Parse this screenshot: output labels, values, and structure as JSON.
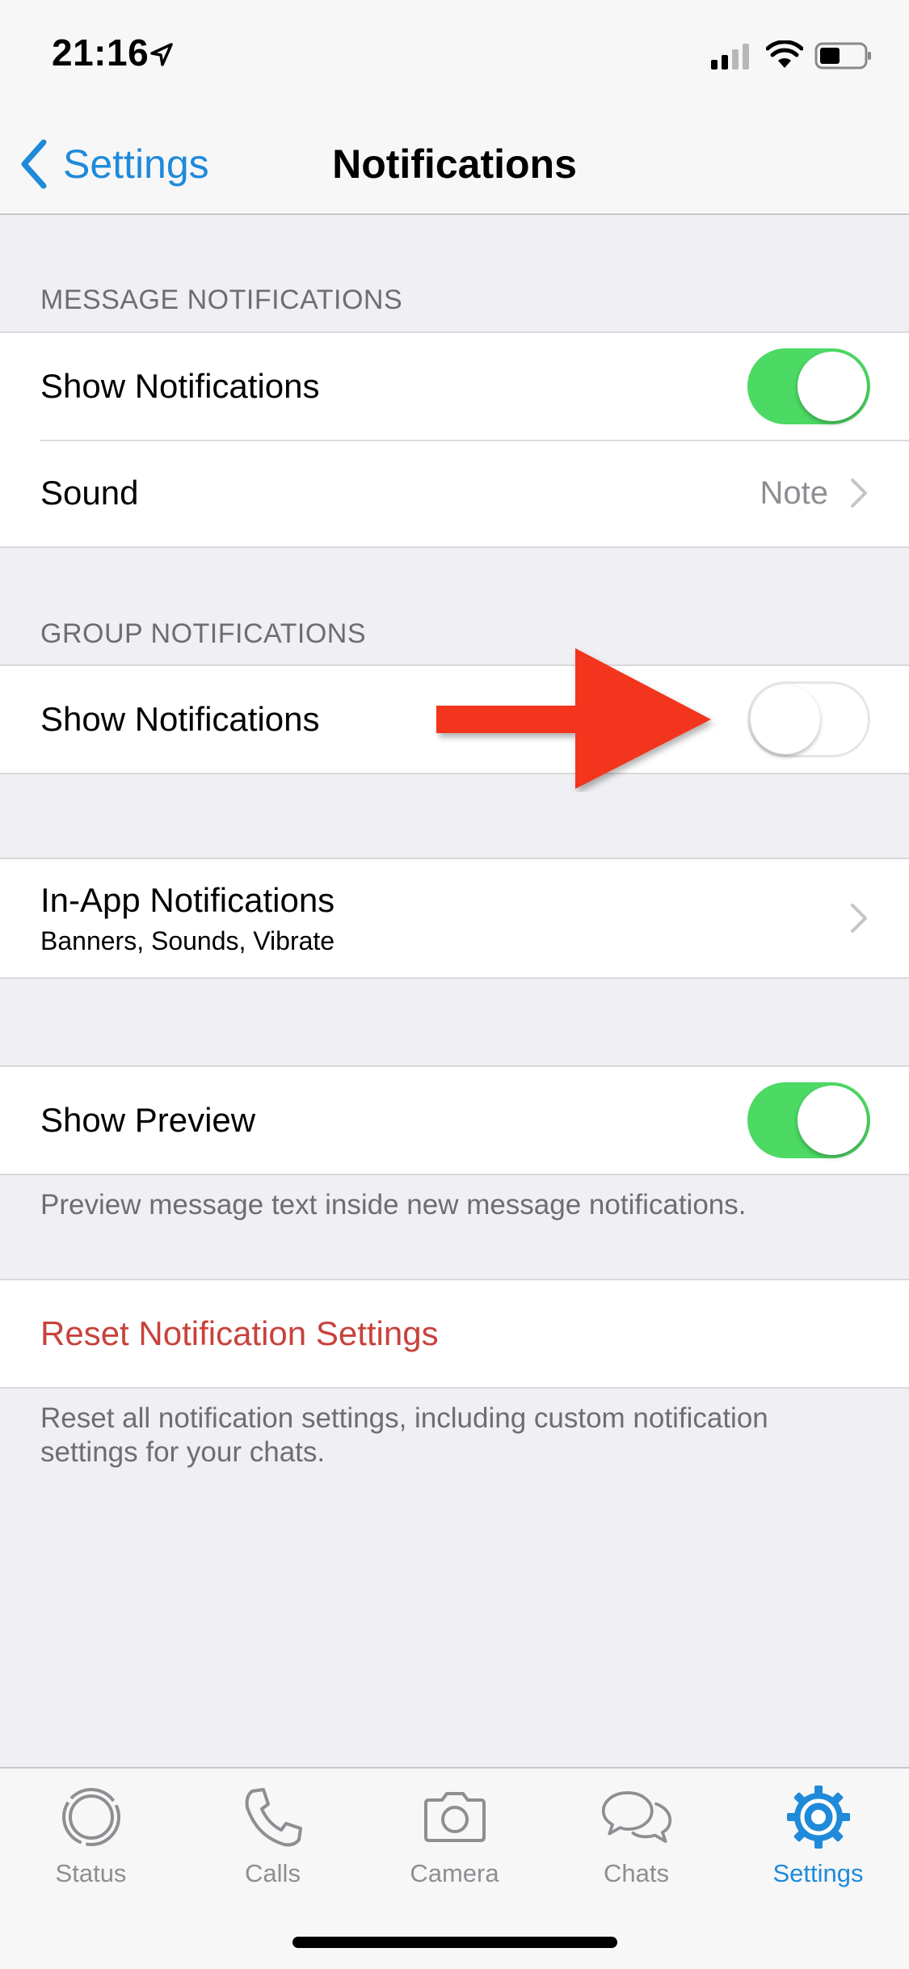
{
  "status_bar": {
    "time": "21:16"
  },
  "nav": {
    "back_label": "Settings",
    "title": "Notifications"
  },
  "message_notifications": {
    "header": "MESSAGE NOTIFICATIONS",
    "show_label": "Show Notifications",
    "show_enabled": true,
    "sound_label": "Sound",
    "sound_value": "Note"
  },
  "group_notifications": {
    "header": "GROUP NOTIFICATIONS",
    "show_label": "Show Notifications",
    "show_enabled": false
  },
  "in_app": {
    "label": "In-App Notifications",
    "subtitle": "Banners, Sounds, Vibrate"
  },
  "preview": {
    "label": "Show Preview",
    "enabled": true,
    "footer": "Preview message text inside new message notifications."
  },
  "reset": {
    "label": "Reset Notification Settings",
    "footer": "Reset all notification settings, including custom notification settings for your chats."
  },
  "tabs": [
    {
      "label": "Status",
      "icon": "status-icon"
    },
    {
      "label": "Calls",
      "icon": "phone-icon"
    },
    {
      "label": "Camera",
      "icon": "camera-icon"
    },
    {
      "label": "Chats",
      "icon": "chats-icon"
    },
    {
      "label": "Settings",
      "icon": "settings-gear-icon",
      "active": true
    }
  ],
  "colors": {
    "accent": "#1f8ad9",
    "toggle_on": "#4cd964",
    "destructive": "#c8423c",
    "annotation_arrow": "#f2361c",
    "background": "#efeff4"
  }
}
